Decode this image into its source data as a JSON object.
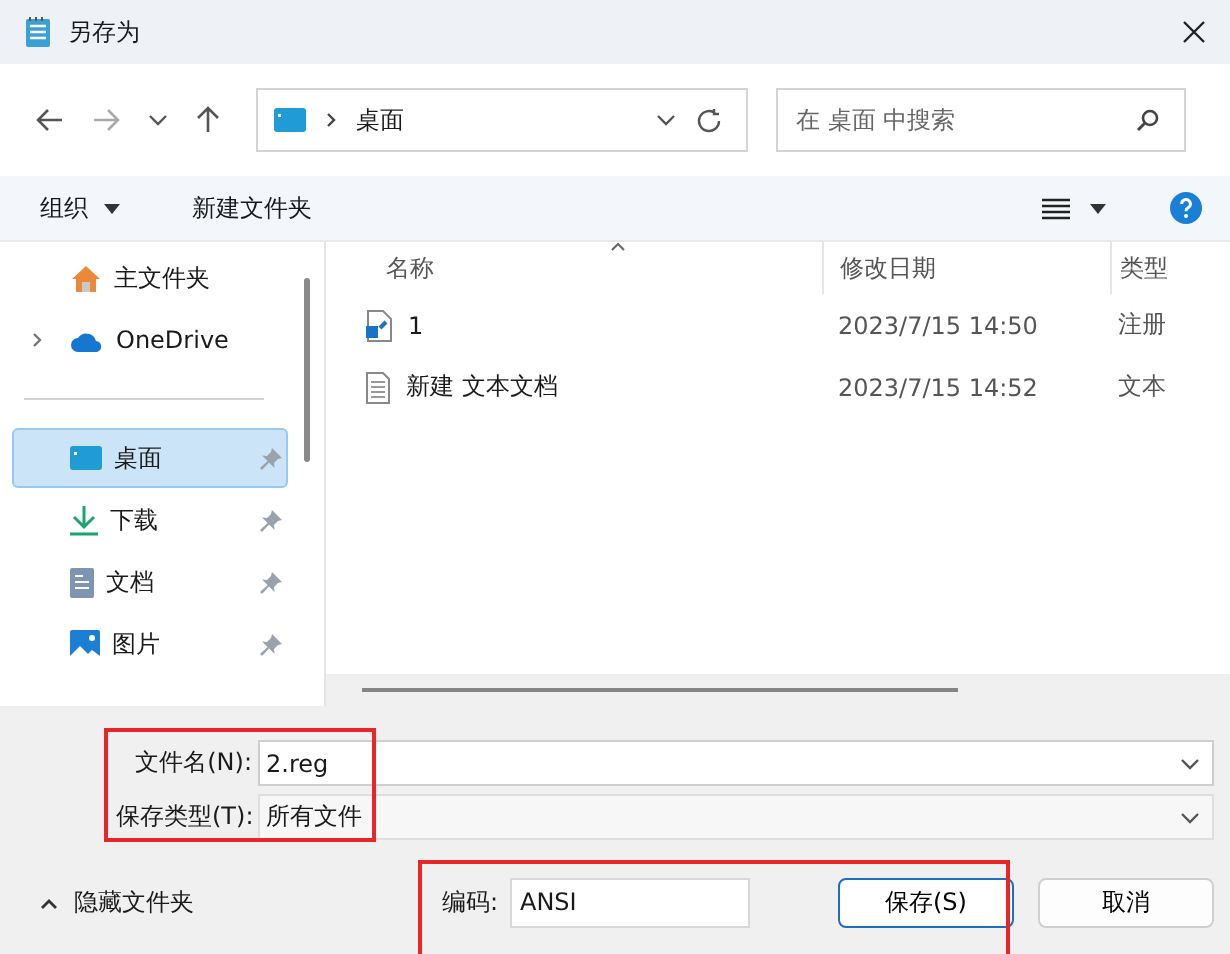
{
  "window": {
    "title": "另存为"
  },
  "address_bar": {
    "path": "桌面"
  },
  "search": {
    "placeholder": "在 桌面 中搜索"
  },
  "toolbar": {
    "organize": "组织",
    "new_folder": "新建文件夹"
  },
  "sidebar": {
    "sections": [
      {
        "items": [
          {
            "label": "主文件夹",
            "kind": "home",
            "pinned": false,
            "expandable": false,
            "selected": false
          },
          {
            "label": "OneDrive",
            "kind": "cloud",
            "pinned": false,
            "expandable": true,
            "selected": false
          }
        ]
      },
      {
        "items": [
          {
            "label": "桌面",
            "kind": "desktop",
            "pinned": true,
            "expandable": false,
            "selected": true
          },
          {
            "label": "下载",
            "kind": "download",
            "pinned": true,
            "expandable": false,
            "selected": false
          },
          {
            "label": "文档",
            "kind": "documents",
            "pinned": true,
            "expandable": false,
            "selected": false
          },
          {
            "label": "图片",
            "kind": "pictures",
            "pinned": true,
            "expandable": false,
            "selected": false
          }
        ]
      }
    ]
  },
  "table": {
    "columns": [
      "名称",
      "修改日期",
      "类型"
    ],
    "rows": [
      {
        "kind": "registry",
        "name": "1",
        "date": "2023/7/15 14:50",
        "type": "注册"
      },
      {
        "kind": "text",
        "name": "新建 文本文档",
        "date": "2023/7/15 14:52",
        "type": "文本"
      }
    ]
  },
  "form": {
    "filename_label": "文件名(N):",
    "filename": "2.reg",
    "filetype_label": "保存类型(T):",
    "filetype": "所有文件",
    "encoding_label": "编码:",
    "encoding": "ANSI"
  },
  "hide_folders": "隐藏文件夹",
  "buttons": [
    "保存(S)",
    "取消"
  ]
}
